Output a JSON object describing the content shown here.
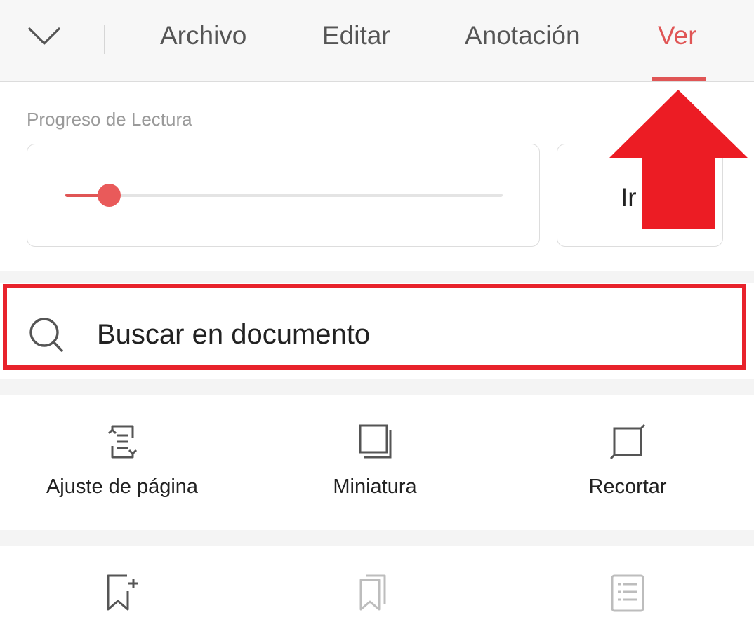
{
  "tabs": [
    {
      "label": "Archivo",
      "active": false
    },
    {
      "label": "Editar",
      "active": false
    },
    {
      "label": "Anotación",
      "active": false
    },
    {
      "label": "Ver",
      "active": true
    }
  ],
  "reading_progress": {
    "label": "Progreso de Lectura",
    "value_fraction": 0.1,
    "goto_label": "Ir"
  },
  "search": {
    "label": "Buscar en documento",
    "icon": "search-icon"
  },
  "tools_row1": [
    {
      "label": "Ajuste de página",
      "icon": "page-fit-icon"
    },
    {
      "label": "Miniatura",
      "icon": "thumbnail-icon"
    },
    {
      "label": "Recortar",
      "icon": "crop-icon"
    }
  ],
  "tools_row2": [
    {
      "icon": "add-bookmark-icon"
    },
    {
      "icon": "bookmarks-icon"
    },
    {
      "icon": "outline-list-icon"
    }
  ],
  "colors": {
    "accent": "#e05555",
    "highlight": "#e8222b",
    "annotation_arrow": "#ec1c24"
  }
}
